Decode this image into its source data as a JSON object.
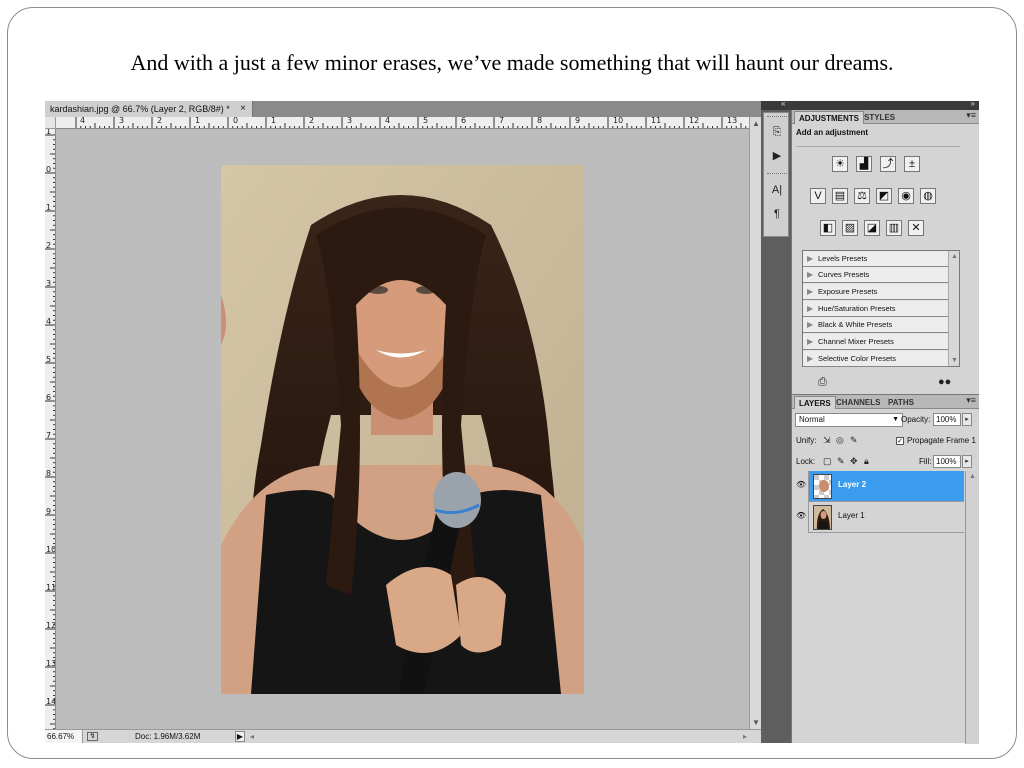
{
  "slide": {
    "caption": "And with a just a few minor erases, we’ve made something that will haunt our dreams."
  },
  "document": {
    "tab_title": "kardashian.jpg @ 66.7% (Layer 2, RGB/8#) *",
    "close_glyph": "×",
    "ruler_top": [
      "4",
      "3",
      "2",
      "1",
      "0",
      "1",
      "2",
      "3",
      "4",
      "5",
      "6",
      "7",
      "8",
      "9",
      "10",
      "11",
      "12",
      "13"
    ],
    "ruler_left": [
      "1",
      "0",
      "1",
      "2",
      "3",
      "4",
      "5",
      "6",
      "7",
      "8",
      "9",
      "10",
      "11",
      "12",
      "13",
      "14"
    ],
    "status": {
      "zoom": "66.67%",
      "doc_size": "Doc: 1.96M/3.62M"
    }
  },
  "adjustments": {
    "tabs": [
      "ADJUSTMENTS",
      "STYLES"
    ],
    "heading": "Add an adjustment",
    "presets": [
      "Levels Presets",
      "Curves Presets",
      "Exposure Presets",
      "Hue/Saturation Presets",
      "Black & White Presets",
      "Channel Mixer Presets",
      "Selective Color Presets"
    ]
  },
  "layers": {
    "tabs": [
      "LAYERS",
      "CHANNELS",
      "PATHS"
    ],
    "blend_mode": "Normal",
    "opacity_label": "Opacity:",
    "opacity_value": "100%",
    "unify_label": "Unify:",
    "propagate_label": "Propagate Frame 1",
    "propagate_checked": "✓",
    "lock_label": "Lock:",
    "fill_label": "Fill:",
    "fill_value": "100%",
    "items": [
      {
        "name": "Layer 2",
        "selected": true
      },
      {
        "name": "Layer 1",
        "selected": false
      }
    ]
  },
  "colors": {
    "selection_blue": "#3b9bef",
    "canvas_gray": "#bcbcbc",
    "panel_gray": "#d4d4d4"
  }
}
